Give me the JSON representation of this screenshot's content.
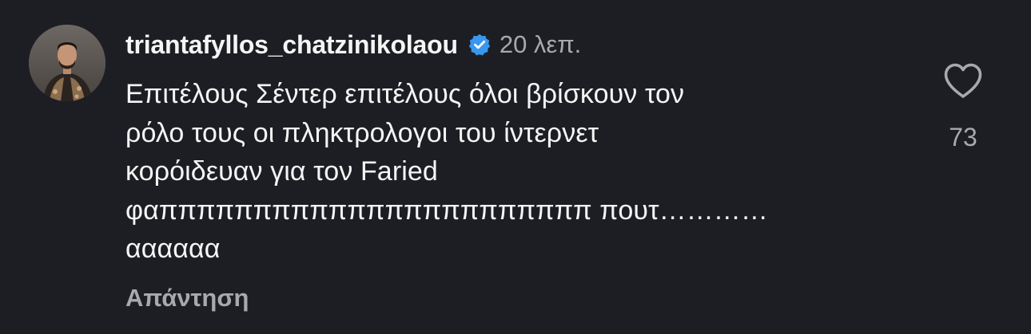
{
  "comment": {
    "username": "triantafyllos_chatzinikolaou",
    "verified_icon": "verified-badge-icon",
    "verified_color": "#3897f0",
    "timestamp": "20 λεπ.",
    "text": "Επιτέλους Σέντερ επιτέλους όλοι βρίσκουν τον\nρόλο τους οι πληκτρολογοι του ίντερνετ\nκορόιδευαν για τον Faried\nφαπππππππππππππππππππππππ πουτ…………\nαααααα",
    "reply_label": "Απάντηση",
    "like_icon": "heart-icon",
    "like_count": "73"
  }
}
